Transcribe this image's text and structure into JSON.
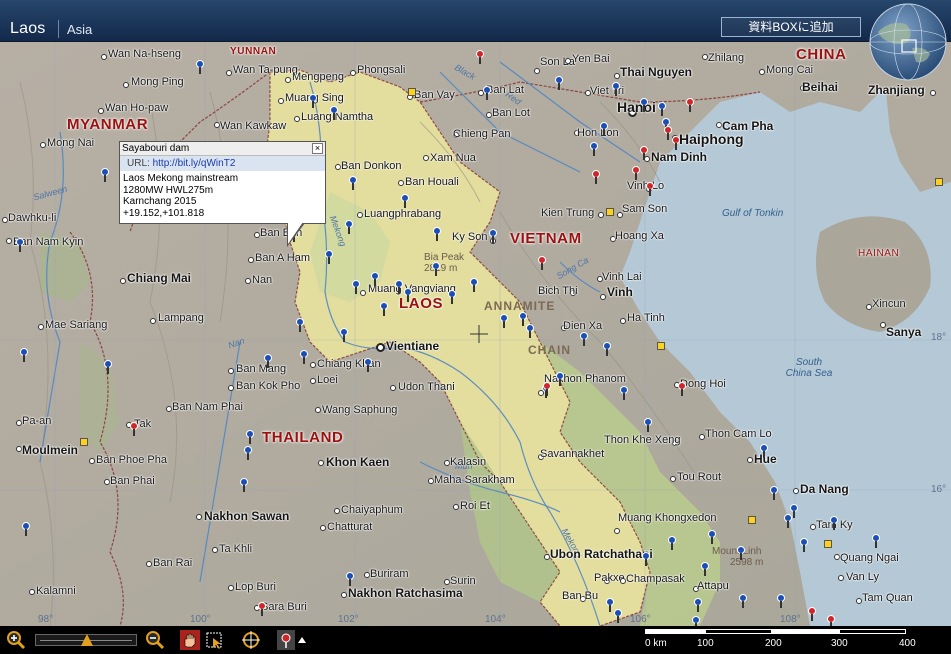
{
  "header": {
    "country": "Laos",
    "region": "Asia",
    "add_box_label": "資料BOXに追加"
  },
  "popup": {
    "title": "Sayabouri dam",
    "close_glyph": "×",
    "url_label": "URL:",
    "url_value": "http://bit.ly/qWinT2",
    "lines": [
      "Laos Mekong mainstream",
      "1280MW HWL275m",
      "Karnchang 2015",
      "+19.152,+101.818"
    ]
  },
  "map": {
    "countries": [
      "MYANMAR",
      "LAOS",
      "VIETNAM",
      "THAILAND",
      "CHINA",
      "HAINAN",
      "YUNNAN"
    ],
    "cities": [
      "Wan Na-hseng",
      "Wan Ta-pung",
      "Mong Ping",
      "Mengpeng",
      "Phongsali",
      "Ban Vay",
      "Wan Ho-paw",
      "Muang Sing",
      "Luang Namtha",
      "Wan Kawkaw",
      "Mong Nai",
      "Ban Donkon",
      "Xam Nua",
      "Ban Houali",
      "Dawhku-li",
      "Luangphrabang",
      "Ban Nam Kyin",
      "Ban Ban",
      "Ban A Ham",
      "Chiang Mai",
      "Nan",
      "Muang Vangviang",
      "Lampang",
      "Mae Sariang",
      "Vientiane",
      "Chiang Khan",
      "Loei",
      "Ban Mang",
      "Ban Kok Pho",
      "Udon Thani",
      "Ban Nam Phai",
      "Wang Saphung",
      "Pa-an",
      "Tak",
      "Moulmein",
      "Ban Phoe Pha",
      "Ban Phai",
      "Khon Kaen",
      "Kalasin",
      "Maha Sarakham",
      "Roi Et",
      "Chaiyaphum",
      "Chatturat",
      "Nakhon Sawan",
      "Ta Khli",
      "Ban Rai",
      "Lop Buri",
      "Kalamni",
      "Sara Buri",
      "Buriram",
      "Nakhon Ratchasima",
      "Surin",
      "Nakhon Phanom",
      "Savannakhet",
      "Muang Khongxedon",
      "Ubon Ratchathani",
      "Pakxe",
      "Champasak",
      "Attapu",
      "Ban Bu",
      "Thai Nguyen",
      "Hanoi",
      "Viet Tri",
      "Ban Lat",
      "Chieng Pan",
      "Son La",
      "Ban Lot",
      "Hon Lon",
      "Nam Dinh",
      "Vinh Lo",
      "Kien Trung",
      "Sam Son",
      "Ky Son",
      "Hoang Xa",
      "Vinh Lai",
      "Vinh",
      "Bich Thi",
      "Ha Tinh",
      "Dien Xa",
      "Dong Hoi",
      "Thon Khe Xeng",
      "Thon Cam Lo",
      "Hue",
      "Da Nang",
      "Tam Ky",
      "Quang Ngai",
      "Van Ly",
      "Tam Quan",
      "Tou Rout",
      "Yen Bai",
      "Zhilang",
      "Mong Cai",
      "Beihai",
      "Zhanjiang",
      "Haiphong",
      "Cam Pha",
      "Xincun",
      "Sanya"
    ],
    "relief_labels": [
      "ANNAMITE",
      "CHAIN"
    ],
    "peaks": [
      {
        "name": "Bia Peak",
        "elev": "2819 m"
      },
      {
        "name": "Mount Linh",
        "elev": "2598 m"
      }
    ],
    "seas": [
      "Gulf of Tonkin",
      "South China Sea"
    ],
    "grid_labels": [
      "98°",
      "100°",
      "102°",
      "104°",
      "106°",
      "108°",
      "18°",
      "16°"
    ],
    "river_labels": [
      "Salween",
      "Mekong",
      "Nan",
      "Black",
      "Red",
      "Song Ca",
      "Mun",
      "Mekong"
    ]
  },
  "toolbar": {
    "zoom_in": "zoom-in",
    "zoom_out": "zoom-out",
    "zoom_level": 0.5,
    "scale": {
      "labels": [
        "0 km",
        "100",
        "200",
        "300",
        "400"
      ]
    }
  },
  "colors": {
    "header_bg": "#1e3a5f",
    "country_label": "#9b1010",
    "laos_fill": "#e6df9e",
    "sea": "#b4c8d6",
    "pin_blue": "#1b4fb6",
    "pin_red": "#d0262b"
  }
}
